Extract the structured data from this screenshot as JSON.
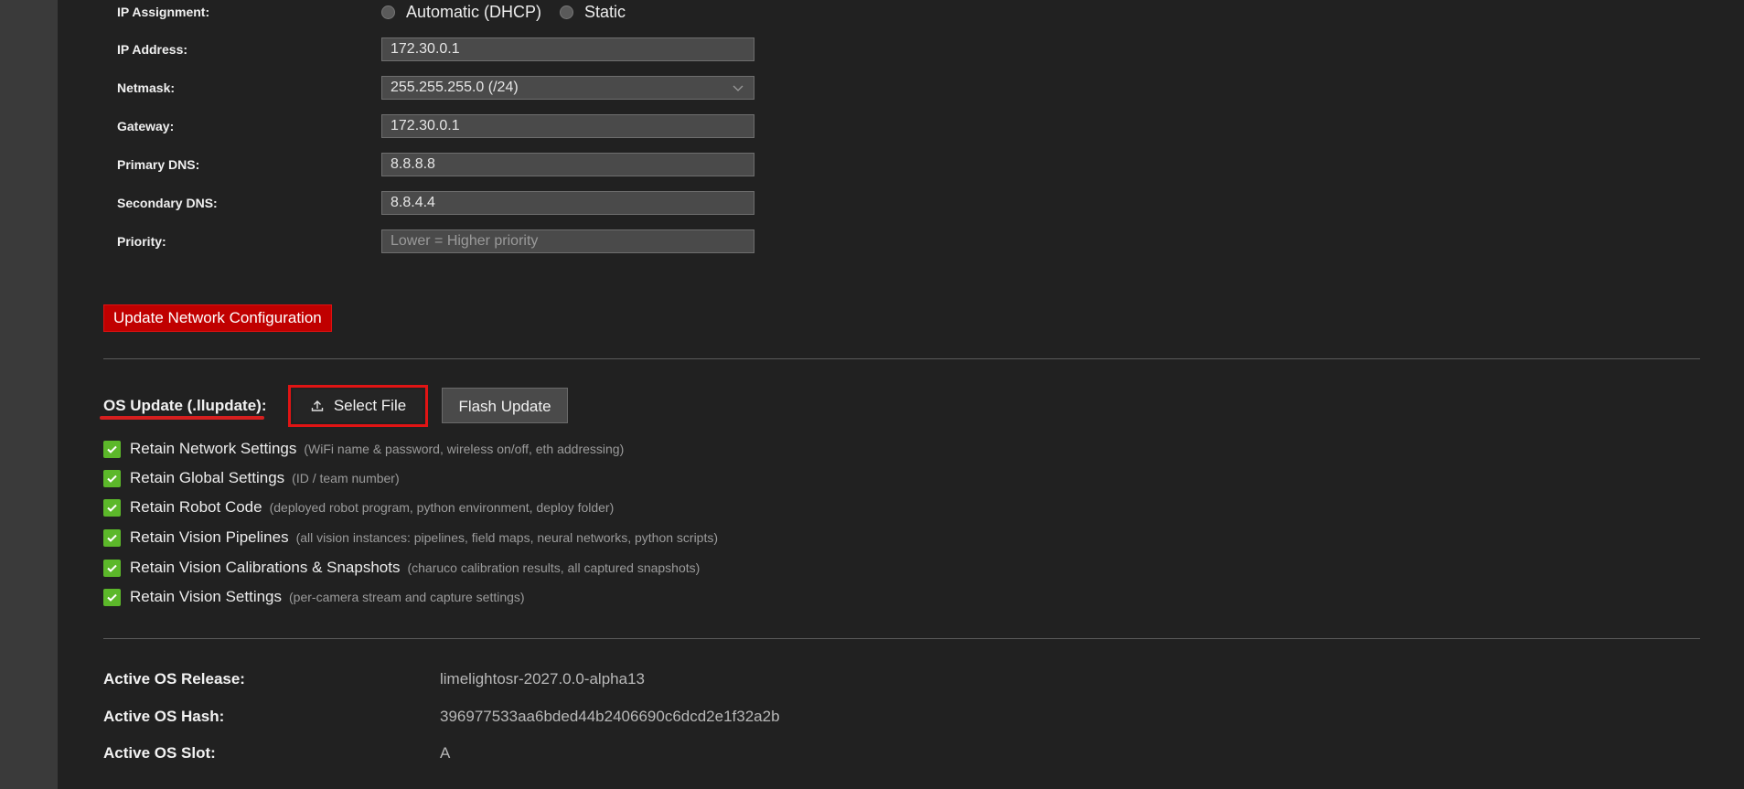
{
  "network": {
    "ip_assignment": {
      "label": "IP Assignment:",
      "options": [
        "Automatic (DHCP)",
        "Static"
      ]
    },
    "ip_address": {
      "label": "IP Address:",
      "value": "172.30.0.1"
    },
    "netmask": {
      "label": "Netmask:",
      "value": "255.255.255.0 (/24)"
    },
    "gateway": {
      "label": "Gateway:",
      "value": "172.30.0.1"
    },
    "primary_dns": {
      "label": "Primary DNS:",
      "value": "8.8.8.8"
    },
    "secondary_dns": {
      "label": "Secondary DNS:",
      "value": "8.8.4.4"
    },
    "priority": {
      "label": "Priority:",
      "value": "",
      "placeholder": "Lower = Higher priority"
    },
    "update_button": "Update Network Configuration"
  },
  "os_update": {
    "label": "OS Update (.llupdate):",
    "select_file": "Select File",
    "flash_update": "Flash Update",
    "options": [
      {
        "label": "Retain Network Settings",
        "desc": "(WiFi name & password, wireless on/off, eth addressing)",
        "checked": true
      },
      {
        "label": "Retain Global Settings",
        "desc": "(ID / team number)",
        "checked": true
      },
      {
        "label": "Retain Robot Code",
        "desc": "(deployed robot program, python environment, deploy folder)",
        "checked": true
      },
      {
        "label": "Retain Vision Pipelines",
        "desc": "(all vision instances: pipelines, field maps, neural networks, python scripts)",
        "checked": true
      },
      {
        "label": "Retain Vision Calibrations & Snapshots",
        "desc": "(charuco calibration results, all captured snapshots)",
        "checked": true
      },
      {
        "label": "Retain Vision Settings",
        "desc": "(per-camera stream and capture settings)",
        "checked": true
      }
    ]
  },
  "os_info": {
    "release": {
      "label": "Active OS Release:",
      "value": "limelightosr-2027.0.0-alpha13"
    },
    "hash": {
      "label": "Active OS Hash:",
      "value": "396977533aa6bded44b2406690c6dcd2e1f32a2b"
    },
    "slot": {
      "label": "Active OS Slot:",
      "value": "A"
    }
  },
  "colors": {
    "background": "#212121",
    "accent_red": "#c00000",
    "checkbox_green": "#5cb82a"
  }
}
